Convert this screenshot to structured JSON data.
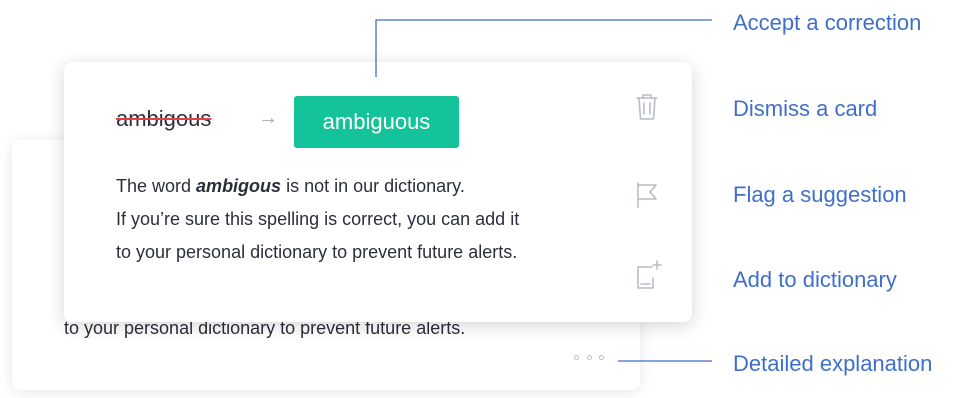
{
  "card": {
    "original_word": "ambigous",
    "arrow": "→",
    "suggestion": "ambiguous",
    "explanation_prefix": "The word ",
    "explanation_word": "ambigous",
    "explanation_suffix": " is not in our dictionary.",
    "explanation_line2": "If you’re sure this spelling is correct, you can add it",
    "explanation_line3": "to your personal dictionary to prevent future alerts."
  },
  "back_card": {
    "text": "to your personal dictionary to prevent future alerts."
  },
  "icons": [
    "trash-icon",
    "flag-icon",
    "add-to-dictionary-icon",
    "more-icon"
  ],
  "callouts": {
    "accept": "Accept a correction",
    "dismiss": "Dismiss a card",
    "flag": "Flag a suggestion",
    "add": "Add to dictionary",
    "detailed": "Detailed explanation"
  },
  "colors": {
    "accent_green": "#15c39a",
    "callout_blue": "#3f6fcb",
    "strike_red": "#e0424a",
    "body_text": "#2b2f3a",
    "icon_gray": "#b8bcc6"
  }
}
